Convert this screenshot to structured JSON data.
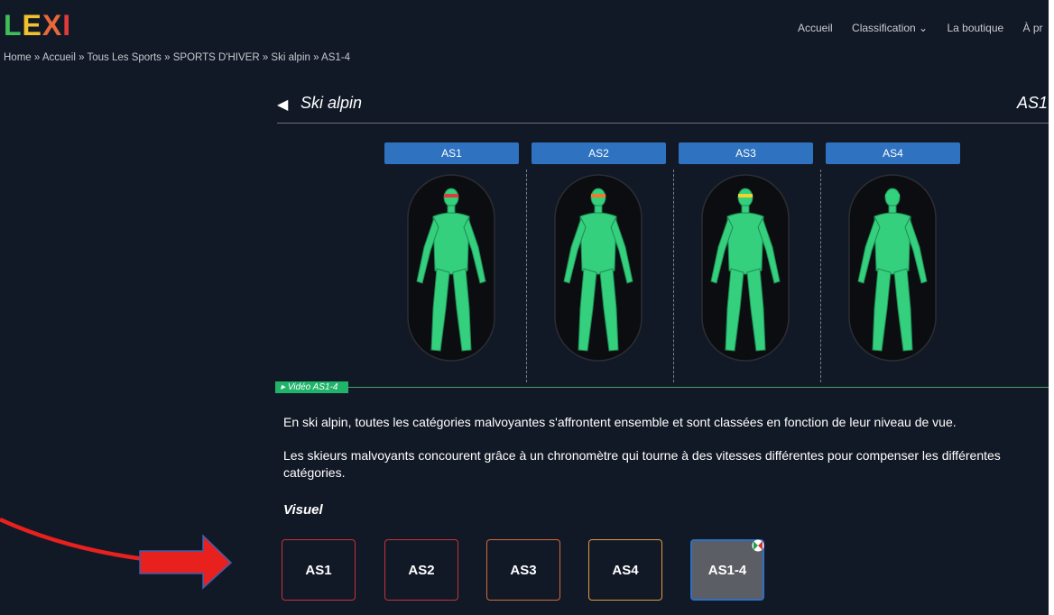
{
  "header": {
    "logo": [
      "L",
      "E",
      "X",
      "I"
    ],
    "logo_colors": [
      "#3fbf5a",
      "#f2c12e",
      "#e8683a",
      "#e23a3a"
    ],
    "nav": [
      "Accueil",
      "Classification ⌄",
      "La boutique",
      "À pr"
    ]
  },
  "breadcrumb": "Home » Accueil » Tous Les Sports » SPORTS D'HIVER » Ski alpin » AS1-4",
  "main": {
    "sport_title": "Ski alpin",
    "category_title": "AS1",
    "tabs": [
      "AS1",
      "AS2",
      "AS3",
      "AS4"
    ],
    "eye_colors": [
      "#e03a3a",
      "#f07a2a",
      "#f2d22e",
      "#2fd47e"
    ],
    "video_label": "Vidéo AS1-4",
    "paragraph1": "En ski alpin, toutes les catégories malvoyantes s'affrontent ensemble et sont classées en fonction de leur niveau de vue.",
    "paragraph2": "Les skieurs malvoyants concourent grâce à un chronomètre qui tourne à des vitesses différentes pour compenser les différentes catégories.",
    "visuel_heading": "Visuel",
    "buttons": [
      {
        "label": "AS1",
        "border": "#c2333a"
      },
      {
        "label": "AS2",
        "border": "#c2333a"
      },
      {
        "label": "AS3",
        "border": "#d3693a"
      },
      {
        "label": "AS4",
        "border": "#e09a3c"
      },
      {
        "label": "AS1-4",
        "border": "#2e6fc2"
      }
    ],
    "selected_button": "AS1-4"
  },
  "colors": {
    "background": "#121926",
    "tab_blue": "#2f72c0",
    "body_green": "#34d07e",
    "video_green": "#20b36a",
    "annotation_red": "#e8211f"
  }
}
